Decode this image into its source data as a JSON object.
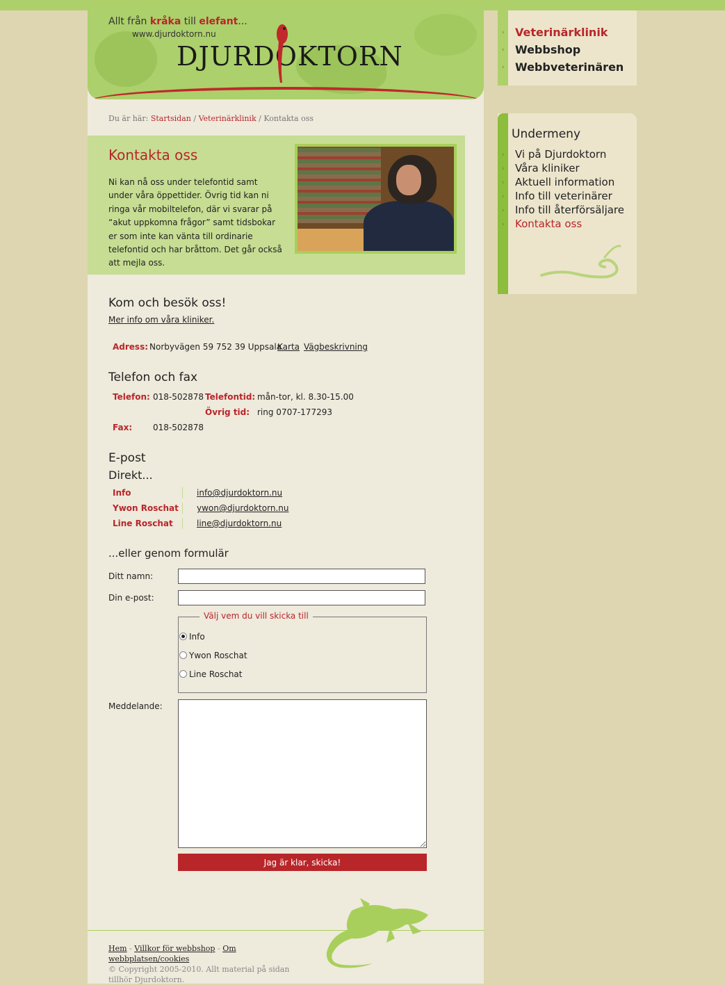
{
  "header": {
    "tagline_prefix": "Allt från",
    "tagline_word1": "kråka",
    "tagline_mid": "till",
    "tagline_word2": "elefant",
    "tagline_suffix": "...",
    "url": "www.djurdoktorn.nu",
    "logo": "DJURDOKTORN"
  },
  "breadcrumb": {
    "prefix": "Du är här:",
    "items": [
      "Startsidan",
      "Veterinärklinik",
      "Kontakta oss"
    ],
    "separator": "/"
  },
  "intro": {
    "title": "Kontakta oss",
    "text": "Ni kan nå oss under telefontid samt under våra öppettider. Övrig tid kan ni ringa vår mobiltelefon, där vi svarar på “akut uppkomna frågor” samt tidsbokar er som inte kan vänta till ordinarie telefontid och har bråttom. Det går också att mejla oss."
  },
  "visit": {
    "heading": "Kom och besök oss!",
    "more_link": "Mer info om våra kliniker.",
    "address_label": "Adress:",
    "address": "Norbyvägen 59 752 39 Uppsala",
    "map_link": "Karta",
    "directions_link": "Vägbeskrivning"
  },
  "phone": {
    "heading": "Telefon och fax",
    "phone_label": "Telefon:",
    "phone": "018-502878",
    "hours_label": "Telefontid:",
    "hours": "mån-tor, kl. 8.30-15.00",
    "other_label": "Övrig tid:",
    "other": "ring 0707-177293",
    "fax_label": "Fax:",
    "fax": "018-502878"
  },
  "email": {
    "heading": "E-post",
    "subheading": "Direkt...",
    "rows": [
      {
        "name": "Info",
        "address": "info@djurdoktorn.nu"
      },
      {
        "name": "Ywon Roschat",
        "address": "ywon@djurdoktorn.nu"
      },
      {
        "name": "Line Roschat",
        "address": "line@djurdoktorn.nu"
      }
    ]
  },
  "form": {
    "heading": "...eller genom formulär",
    "name_label": "Ditt namn:",
    "name_value": "",
    "email_label": "Din e-post:",
    "email_value": "",
    "recipient_legend": "Välj vem du vill skicka till",
    "recipients": [
      "Info",
      "Ywon Roschat",
      "Line Roschat"
    ],
    "selected_recipient": "Info",
    "message_label": "Meddelande:",
    "message_value": "",
    "submit": "Jag är klar, skicka!"
  },
  "footer": {
    "links": [
      "Hem",
      "Villkor för webbshop",
      "Om webbplatsen/cookies"
    ],
    "separator": "-",
    "copyright": "© Copyright 2005-2010. Allt material på sidan tillhör Djurdoktorn."
  },
  "main_nav": {
    "items": [
      "Veterinärklinik",
      "Webbshop",
      "Webbveterinären"
    ],
    "active": "Veterinärklinik"
  },
  "submenu": {
    "title": "Undermeny",
    "items": [
      "Vi på Djurdoktorn",
      "Våra kliniker",
      "Aktuell information",
      "Info till veterinärer",
      "Info till återförsäljare",
      "Kontakta oss"
    ],
    "active": "Kontakta oss"
  },
  "colors": {
    "accent_red": "#b8262a",
    "brand_green": "#aed06a",
    "light_green": "#c6dd93",
    "page_bg": "#ded6b0",
    "content_bg": "#eeeadc"
  }
}
